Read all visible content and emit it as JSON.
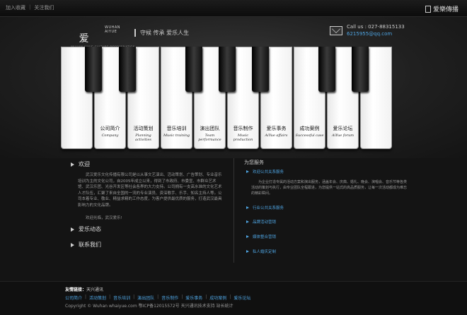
{
  "topbar": {
    "links": [
      "加入收藏",
      "关注我们"
    ],
    "logo_text": "爱樂傳播"
  },
  "header": {
    "brand_en": "WUHAN AIYUE",
    "brand_cn": "爱樂傳播",
    "brand_sub": "WUHAN AIYUE CULTURE DESSIMINATION",
    "slogan": "守候 传承 爱乐人生",
    "call": "Call us : 027-88315133",
    "qq": "6215955@qq.com"
  },
  "nav": [
    {
      "cn": "公司简介",
      "en": "Company"
    },
    {
      "cn": "活动策划",
      "en": "Planning activities"
    },
    {
      "cn": "音乐培训",
      "en": "Music training"
    },
    {
      "cn": "演出团队",
      "en": "Team performance"
    },
    {
      "cn": "音乐制作",
      "en": "Music production"
    },
    {
      "cn": "爱乐事务",
      "en": "AiYue affairs"
    },
    {
      "cn": "成功案例",
      "en": "Successful case"
    },
    {
      "cn": "爱乐论坛",
      "en": "AiYue forum"
    }
  ],
  "welcome": {
    "title": "欢迎",
    "text": "武汉爱乐文化传播有限公司是以从事文艺演出、活动策划、广告策划、专业音乐培训为主的文化公司，自2005年成立以来，得到了市政府、市委宣、市群众艺术馆、武汉乐团、光谷开发区等社会各界的大力支持。公司拥有一支高水准的文化艺术人才队伍，汇聚了来自全国的一流的专业演员、资深歌手、乐手、知名主持人等。公司本着专业、敬业、精益求精的工作态度，为客户提供最优质的服务，打造武汉最具影响力的文化品牌。",
    "more": "欢迎光临，武汉爱乐!"
  },
  "news_title": "爱乐动态",
  "contact_title": "联系我们",
  "services": {
    "title": "为您服务",
    "first": "欢迎公共关系服务",
    "desc": "为企业打造专属的活动方案和演出服务，涵盖年会、庆典、婚礼、晚会、演唱会、音乐节等各类活动的策划与执行，由专业团队全程跟进，为您提供一站式的高品质服务，让每一次活动都成为难忘的精彩瞬间。",
    "items": [
      "行业公共关系服务",
      "品牌活动营销",
      "媒体整合营销",
      "私人婚庆定制"
    ]
  },
  "footer": {
    "links_label": "友情链接：",
    "links_value": "天兴通讯",
    "links": [
      "公司简介",
      "活动策划",
      "音乐培训",
      "演出团队",
      "音乐制作",
      "爱乐事务",
      "成功案例",
      "爱乐论坛"
    ],
    "copyright": "Copyright © Wuhan whaiyue.com  鄂ICP备12015572号  天兴通讯技术支持  站长统计"
  }
}
